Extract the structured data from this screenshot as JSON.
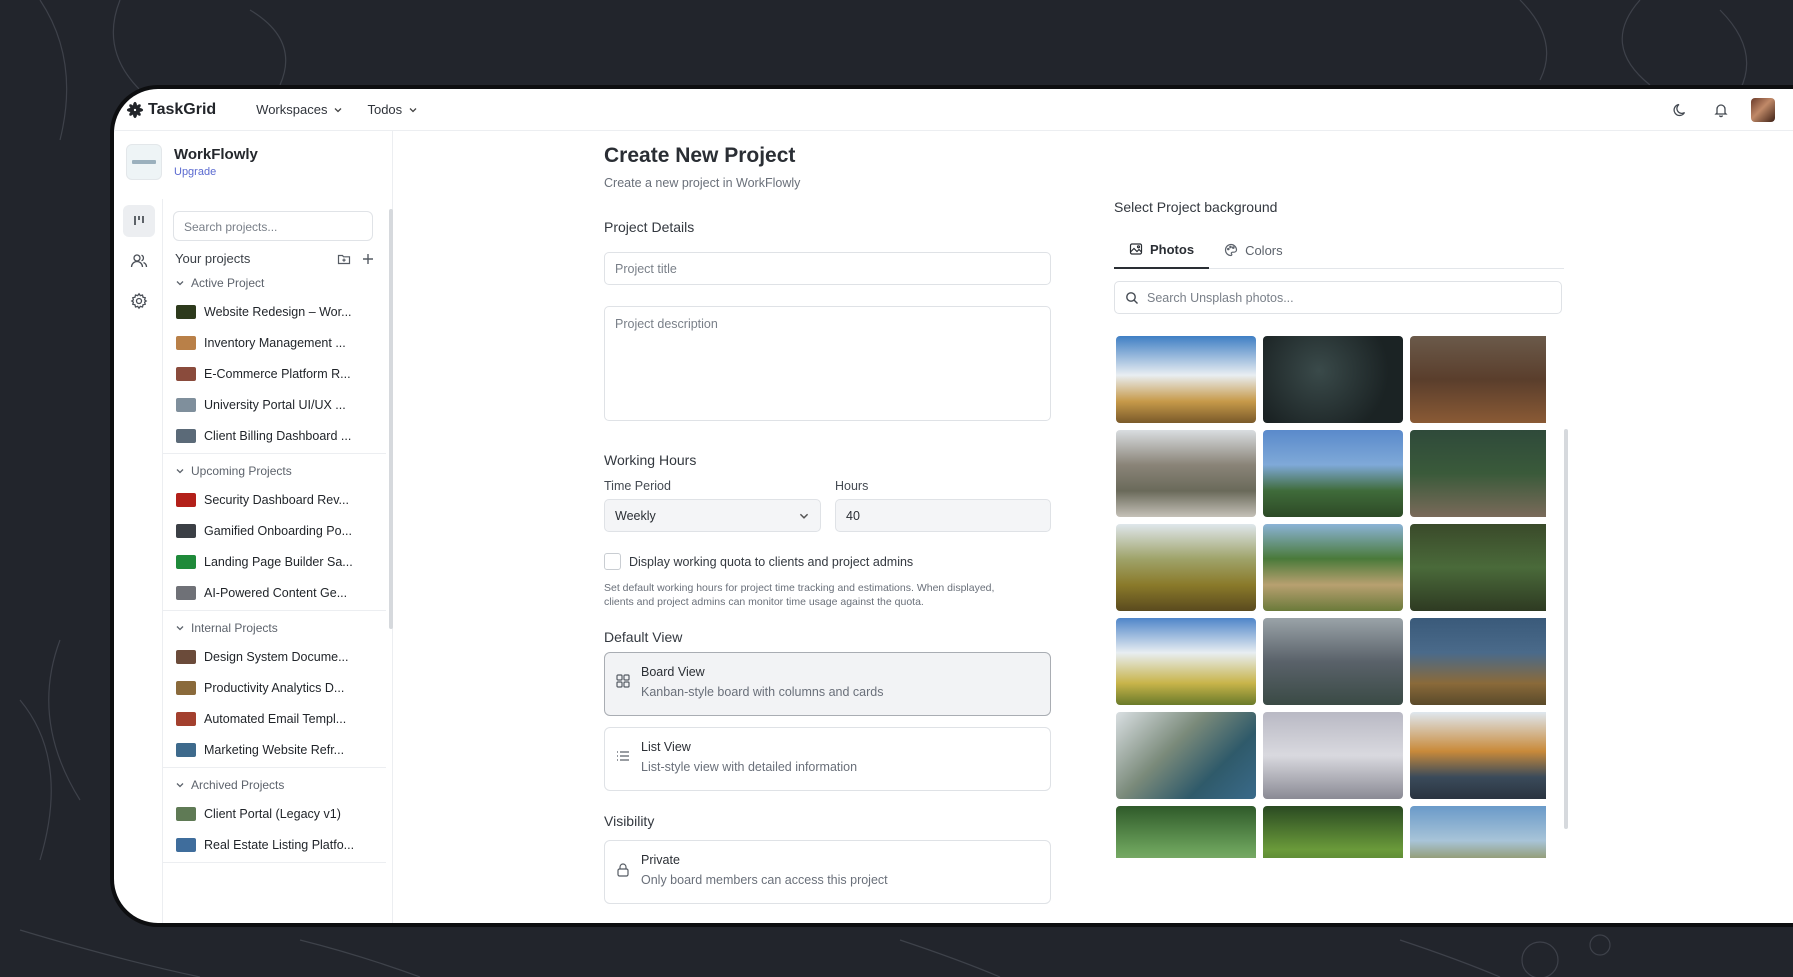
{
  "app": {
    "name": "TaskGrid",
    "nav": [
      {
        "label": "Workspaces"
      },
      {
        "label": "Todos"
      }
    ]
  },
  "org": {
    "name": "WorkFlowly",
    "upgrade_label": "Upgrade"
  },
  "sidebar": {
    "search_placeholder": "Search projects...",
    "your_projects_label": "Your projects",
    "groups": [
      {
        "label": "Active Project",
        "items": [
          {
            "label": "Website Redesign – Wor...",
            "thumb": "#2d3a1c"
          },
          {
            "label": "Inventory Management ...",
            "thumb": "#b98048"
          },
          {
            "label": "E-Commerce Platform R...",
            "thumb": "#8a4b3c"
          },
          {
            "label": "University Portal UI/UX ...",
            "thumb": "#7f8f9c"
          },
          {
            "label": "Client Billing Dashboard ...",
            "thumb": "#5b6a78"
          }
        ]
      },
      {
        "label": "Upcoming Projects",
        "items": [
          {
            "label": "Security Dashboard Rev...",
            "thumb": "#b3201a"
          },
          {
            "label": "Gamified Onboarding Po...",
            "thumb": "#3b3f45"
          },
          {
            "label": "Landing Page Builder Sa...",
            "thumb": "#1f8a3a"
          },
          {
            "label": "AI-Powered Content Ge...",
            "thumb": "#6f7177"
          }
        ]
      },
      {
        "label": "Internal Projects",
        "items": [
          {
            "label": "Design System Docume...",
            "thumb": "#6b4b3a"
          },
          {
            "label": "Productivity Analytics D...",
            "thumb": "#8a6a3b"
          },
          {
            "label": "Automated Email Templ...",
            "thumb": "#a3402e"
          },
          {
            "label": "Marketing Website Refr...",
            "thumb": "#3e6a8c"
          }
        ]
      },
      {
        "label": "Archived Projects",
        "items": [
          {
            "label": "Client Portal (Legacy v1)",
            "thumb": "#5f7a55"
          },
          {
            "label": "Real Estate Listing Platfo...",
            "thumb": "#3f6d9c"
          }
        ]
      }
    ]
  },
  "main": {
    "title": "Create New Project",
    "subtitle": "Create a new project in WorkFlowly",
    "details_label": "Project Details",
    "title_placeholder": "Project title",
    "description_placeholder": "Project description",
    "working_hours_label": "Working Hours",
    "time_period_label": "Time Period",
    "time_period_value": "Weekly",
    "hours_label": "Hours",
    "hours_value": "40",
    "quota_checkbox_label": "Display working quota to clients and project admins",
    "quota_hint_1": "Set default working hours for project time tracking and estimations. When displayed,",
    "quota_hint_2": "clients and project admins can monitor time usage against the quota.",
    "default_view_label": "Default View",
    "views": [
      {
        "title": "Board View",
        "subtitle": "Kanban-style board with columns and cards"
      },
      {
        "title": "List View",
        "subtitle": "List-style view with detailed information"
      }
    ],
    "visibility_label": "Visibility",
    "visibility": {
      "title": "Private",
      "subtitle": "Only board members can access this project"
    }
  },
  "background": {
    "label": "Select Project background",
    "tabs": [
      {
        "label": "Photos"
      },
      {
        "label": "Colors"
      }
    ],
    "search_placeholder": "Search Unsplash photos...",
    "photos": [
      "linear-gradient(180deg,#3f7fc4 0%,#e9eef2 45%,#c79a4a 75%,#7a5a2a 100%)",
      "radial-gradient(circle at 40% 40%,#3a4a4a,#1b2324 70%)",
      "linear-gradient(180deg,#6b5a4a 0%,#5a3e2c 50%,#8a5a35 100%)",
      "linear-gradient(180deg,#d9dde0 0%,#8a8478 40%,#6a6a5a 70%,#c5c1b8 100%)",
      "linear-gradient(180deg,#5a8acb 0%,#7fa9d8 40%,#3f6b3a 70%,#2d4a26 100%)",
      "linear-gradient(180deg,#2f4a3a 0%,#3a5a3a 50%,#7a6a5a 100%)",
      "linear-gradient(180deg,#dfe7ec 0%,#9fa36a 40%,#8a7a2a 70%,#5a4a1e 100%)",
      "linear-gradient(180deg,#8bb3d6 0%,#4a7a3a 40%,#b8a070 70%,#6a7a3a 100%)",
      "linear-gradient(180deg,#3a4a2a 0%,#4a6a3a 50%,#2e3a22 100%)",
      "linear-gradient(180deg,#4f86c9 0%,#e8eef2 40%,#c8b44a 75%,#6a7a2a 100%)",
      "linear-gradient(180deg,#9aa3a8 0%,#5a626a 50%,#3a4a45 100%)",
      "linear-gradient(180deg,#3a5a7a 0%,#4a6a8a 40%,#8a6a3a 75%,#5a4a2a 100%)",
      "linear-gradient(135deg,#d9dfe2 0%,#7a8a7a 40%,#2f5a6a 70%,#3a6a8a 100%)",
      "linear-gradient(180deg,#b9b9c4 0%,#d9d9df 50%,#8a8a94 100%)",
      "linear-gradient(180deg,#dfe7ef 0%,#c98a3a 45%,#3a4a5a 75%,#2a3440 100%)",
      "linear-gradient(180deg,#2f5a2a 0%,#6aa05a 50%,#a8c88a 100%)",
      "linear-gradient(180deg,#2a4a22 0%,#6a9a3a 50%,#3a5a22 100%)",
      "linear-gradient(180deg,#6a9ac9 0%,#a8c4d8 40%,#8a8a4a 70%,#4a5a3a 100%)"
    ]
  },
  "colors": {
    "accent": "#5b6ad0",
    "page_bg": "#22252c"
  },
  "icons": {
    "logo": "asterisk-flower-icon",
    "theme": "moon-icon",
    "notifications": "bell-icon",
    "rail": [
      "board-icon",
      "users-icon",
      "gear-icon"
    ],
    "board_view": "grid-icon",
    "list_view": "list-icon",
    "visibility": "lock-icon",
    "photos_tab": "image-icon",
    "colors_tab": "palette-icon",
    "search": "search-icon"
  }
}
